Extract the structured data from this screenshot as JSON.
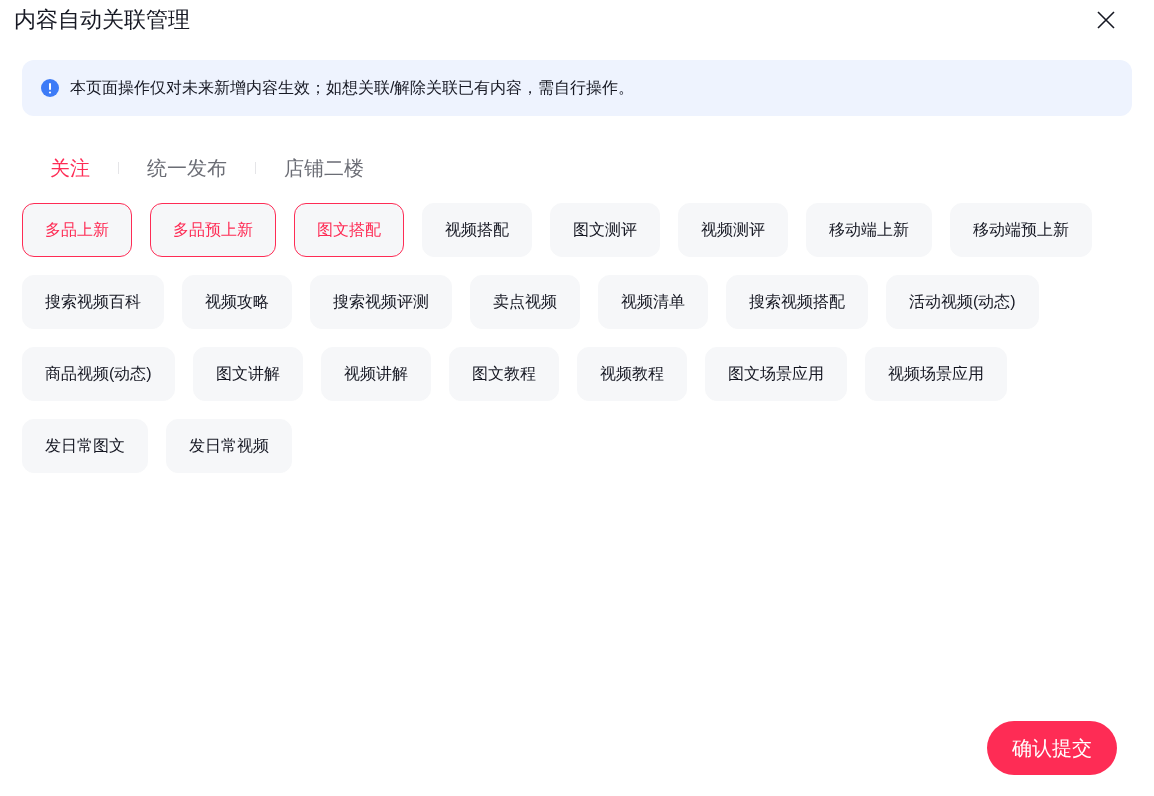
{
  "dialog": {
    "title": "内容自动关联管理"
  },
  "notice": {
    "text": "本页面操作仅对未来新增内容生效；如想关联/解除关联已有内容，需自行操作。"
  },
  "tabs": [
    {
      "label": "关注",
      "selected": true
    },
    {
      "label": "统一发布",
      "selected": false
    },
    {
      "label": "店铺二楼",
      "selected": false
    }
  ],
  "tags": [
    {
      "label": "多品上新",
      "selected": true
    },
    {
      "label": "多品预上新",
      "selected": true
    },
    {
      "label": "图文搭配",
      "selected": true
    },
    {
      "label": "视频搭配",
      "selected": false
    },
    {
      "label": "图文测评",
      "selected": false
    },
    {
      "label": "视频测评",
      "selected": false
    },
    {
      "label": "移动端上新",
      "selected": false
    },
    {
      "label": "移动端预上新",
      "selected": false
    },
    {
      "label": "搜索视频百科",
      "selected": false
    },
    {
      "label": "视频攻略",
      "selected": false
    },
    {
      "label": "搜索视频评测",
      "selected": false
    },
    {
      "label": "卖点视频",
      "selected": false
    },
    {
      "label": "视频清单",
      "selected": false
    },
    {
      "label": "搜索视频搭配",
      "selected": false
    },
    {
      "label": "活动视频(动态)",
      "selected": false
    },
    {
      "label": "商品视频(动态)",
      "selected": false
    },
    {
      "label": "图文讲解",
      "selected": false
    },
    {
      "label": "视频讲解",
      "selected": false
    },
    {
      "label": "图文教程",
      "selected": false
    },
    {
      "label": "视频教程",
      "selected": false
    },
    {
      "label": "图文场景应用",
      "selected": false
    },
    {
      "label": "视频场景应用",
      "selected": false
    },
    {
      "label": "发日常图文",
      "selected": false
    },
    {
      "label": "发日常视频",
      "selected": false
    }
  ],
  "submit_button": {
    "label": "确认提交"
  }
}
